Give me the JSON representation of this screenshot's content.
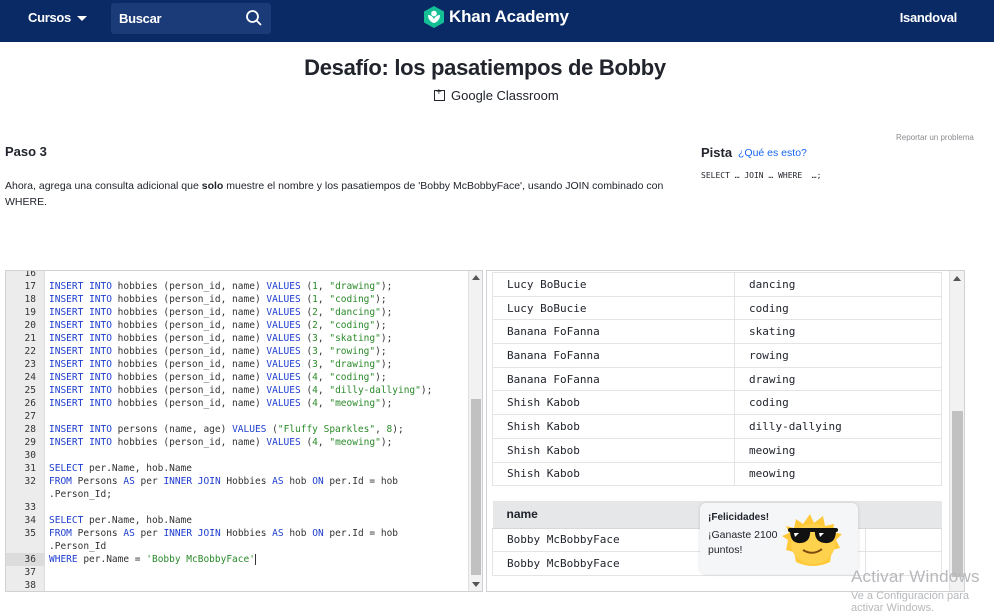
{
  "nav": {
    "courses_label": "Cursos",
    "search_placeholder": "Buscar",
    "brand_name": "Khan Academy",
    "username": "Isandoval",
    "bar_color": "#0a2a66"
  },
  "header": {
    "title": "Desafío: los pasatiempos de Bobby",
    "classroom_label": "Google Classroom",
    "report_label": "Reportar un problema"
  },
  "step": {
    "title": "Paso 3",
    "instruction_before": "Ahora, agrega una consulta adicional que ",
    "instruction_bold": "solo",
    "instruction_after": " muestre el nombre y los pasatiempos de 'Bobby McBobbyFace', usando JOIN combinado con WHERE."
  },
  "hint": {
    "title": "Pista",
    "link": "¿Qué es esto?",
    "code": "SELECT … JOIN … WHERE  …;"
  },
  "editor": {
    "lines": [
      {
        "n": "16",
        "t": ""
      },
      {
        "n": "17",
        "t": "INSERT INTO hobbies (person_id, name) VALUES (1, \"drawing\");"
      },
      {
        "n": "18",
        "t": "INSERT INTO hobbies (person_id, name) VALUES (1, \"coding\");"
      },
      {
        "n": "19",
        "t": "INSERT INTO hobbies (person_id, name) VALUES (2, \"dancing\");"
      },
      {
        "n": "20",
        "t": "INSERT INTO hobbies (person_id, name) VALUES (2, \"coding\");"
      },
      {
        "n": "21",
        "t": "INSERT INTO hobbies (person_id, name) VALUES (3, \"skating\");"
      },
      {
        "n": "22",
        "t": "INSERT INTO hobbies (person_id, name) VALUES (3, \"rowing\");"
      },
      {
        "n": "23",
        "t": "INSERT INTO hobbies (person_id, name) VALUES (3, \"drawing\");"
      },
      {
        "n": "24",
        "t": "INSERT INTO hobbies (person_id, name) VALUES (4, \"coding\");"
      },
      {
        "n": "25",
        "t": "INSERT INTO hobbies (person_id, name) VALUES (4, \"dilly-dallying\");"
      },
      {
        "n": "26",
        "t": "INSERT INTO hobbies (person_id, name) VALUES (4, \"meowing\");"
      },
      {
        "n": "27",
        "t": ""
      },
      {
        "n": "28",
        "t": "INSERT INTO persons (name, age) VALUES (\"Fluffy Sparkles\", 8);"
      },
      {
        "n": "29",
        "t": "INSERT INTO hobbies (person_id, name) VALUES (4, \"meowing\");"
      },
      {
        "n": "30",
        "t": ""
      },
      {
        "n": "31",
        "t": "SELECT per.Name, hob.Name"
      },
      {
        "n": "32",
        "t": "FROM Persons AS per INNER JOIN Hobbies AS hob ON per.Id = hob"
      },
      {
        "n": "",
        "t": ".Person_Id;"
      },
      {
        "n": "33",
        "t": ""
      },
      {
        "n": "34",
        "t": "SELECT per.Name, hob.Name"
      },
      {
        "n": "35",
        "t": "FROM Persons AS per INNER JOIN Hobbies AS hob ON per.Id = hob"
      },
      {
        "n": "",
        "t": ".Person_Id"
      },
      {
        "n": "36",
        "t": "WHERE per.Name = 'Bobby McBobbyFace'"
      },
      {
        "n": "37",
        "t": ""
      },
      {
        "n": "38",
        "t": ""
      }
    ],
    "active_line": "36"
  },
  "results": {
    "table1": [
      [
        "Lucy BoBucie",
        "dancing"
      ],
      [
        "Lucy BoBucie",
        "coding"
      ],
      [
        "Banana FoFanna",
        "skating"
      ],
      [
        "Banana FoFanna",
        "rowing"
      ],
      [
        "Banana FoFanna",
        "drawing"
      ],
      [
        "Shish Kabob",
        "coding"
      ],
      [
        "Shish Kabob",
        "dilly-dallying"
      ],
      [
        "Shish Kabob",
        "meowing"
      ],
      [
        "Shish Kabob",
        "meowing"
      ]
    ],
    "table2_header": "name",
    "table2": [
      [
        "Bobby McBobbyFace",
        ""
      ],
      [
        "Bobby McBobbyFace",
        ""
      ]
    ]
  },
  "toast": {
    "title": "¡Felicidades!",
    "message": "¡Ganaste 2100 puntos!"
  },
  "watermark": {
    "line1": "Activar Windows",
    "line2": "Ve a Configuración para activar Windows."
  }
}
